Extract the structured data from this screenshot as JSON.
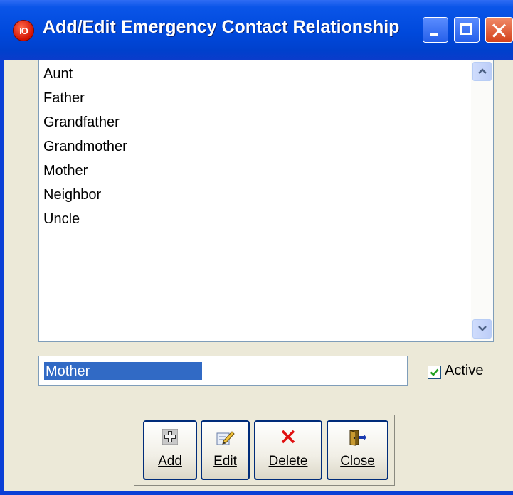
{
  "window": {
    "app_icon_text": "IO",
    "title": "Add/Edit Emergency Contact Relationship"
  },
  "relationships": {
    "items": [
      "Aunt",
      "Father",
      "Grandfather",
      "Grandmother",
      "Mother",
      "Neighbor",
      "Uncle"
    ]
  },
  "editor": {
    "value": "Mother",
    "active_label": "Active",
    "active_checked": true
  },
  "toolbar": {
    "add_label": "Add",
    "edit_label": "Edit",
    "delete_label": "Delete",
    "close_label": "Close"
  },
  "icons": {
    "app": "red-circle-io-icon",
    "minimize": "minimize-icon",
    "maximize": "maximize-icon",
    "close": "close-icon",
    "scroll_up": "chevron-up-icon",
    "scroll_down": "chevron-down-icon",
    "add": "plus-icon",
    "edit": "pencil-icon",
    "delete": "red-x-icon",
    "exit": "door-exit-icon"
  },
  "colors": {
    "titlebar": "#0049dc",
    "selection": "#316ac5",
    "client_bg": "#ece9d8"
  }
}
